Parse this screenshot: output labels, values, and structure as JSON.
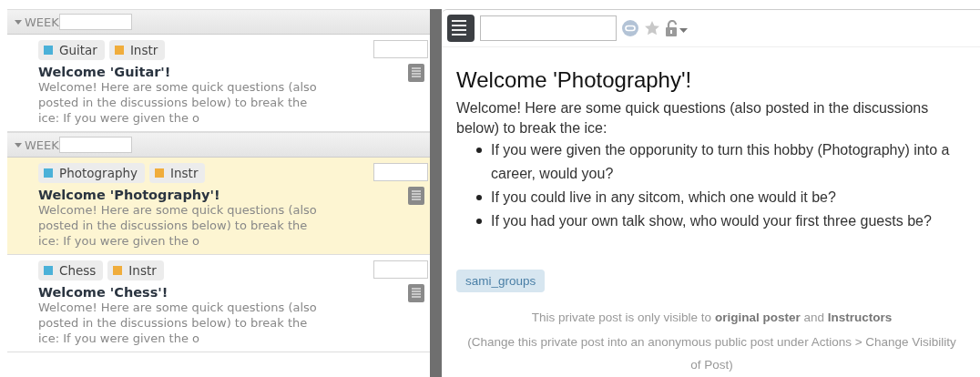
{
  "weeks": [
    {
      "label": "WEEK",
      "expanded": true,
      "posts": [
        {
          "selected": false,
          "tags": [
            {
              "text": "Guitar",
              "color": "#4bb1d8"
            },
            {
              "text": "Instr",
              "color": "#f0ad3c"
            }
          ],
          "title": "Welcome 'Guitar'!",
          "snippet": "Welcome! Here are some quick questions (also posted in the discussions below) to break the ice: If you were given the o"
        }
      ]
    },
    {
      "label": "WEEK",
      "expanded": true,
      "posts": [
        {
          "selected": true,
          "tags": [
            {
              "text": "Photography",
              "color": "#4bb1d8"
            },
            {
              "text": "Instr",
              "color": "#f0ad3c"
            }
          ],
          "title": "Welcome 'Photography'!",
          "snippet": "Welcome! Here are some quick questions (also posted in the discussions below) to break the ice: If you were given the o"
        },
        {
          "selected": false,
          "tags": [
            {
              "text": "Chess",
              "color": "#4bb1d8"
            },
            {
              "text": "Instr",
              "color": "#f0ad3c"
            }
          ],
          "title": "Welcome 'Chess'!",
          "snippet": "Welcome! Here are some quick questions (also posted in the discussions below) to break the ice: If you were given the o"
        }
      ]
    }
  ],
  "detail": {
    "starred": false,
    "title": "Welcome 'Photography'!",
    "intro": "Welcome! Here are some quick questions (also posted in the discussions below) to break the ice:",
    "bullets": [
      "If you were given the opporunity to turn this hobby (Photography) into a career, would you?",
      "If you could live in any sitcom, which one would it be?",
      "If you had your own talk show, who would your first three guests be?"
    ],
    "tag": "sami_groups",
    "notice": "This private post is only visible to **original poster** and **Instructors**",
    "hint": "(Change this private post into an anonymous public post under Actions > Change Visibility of Post)"
  }
}
